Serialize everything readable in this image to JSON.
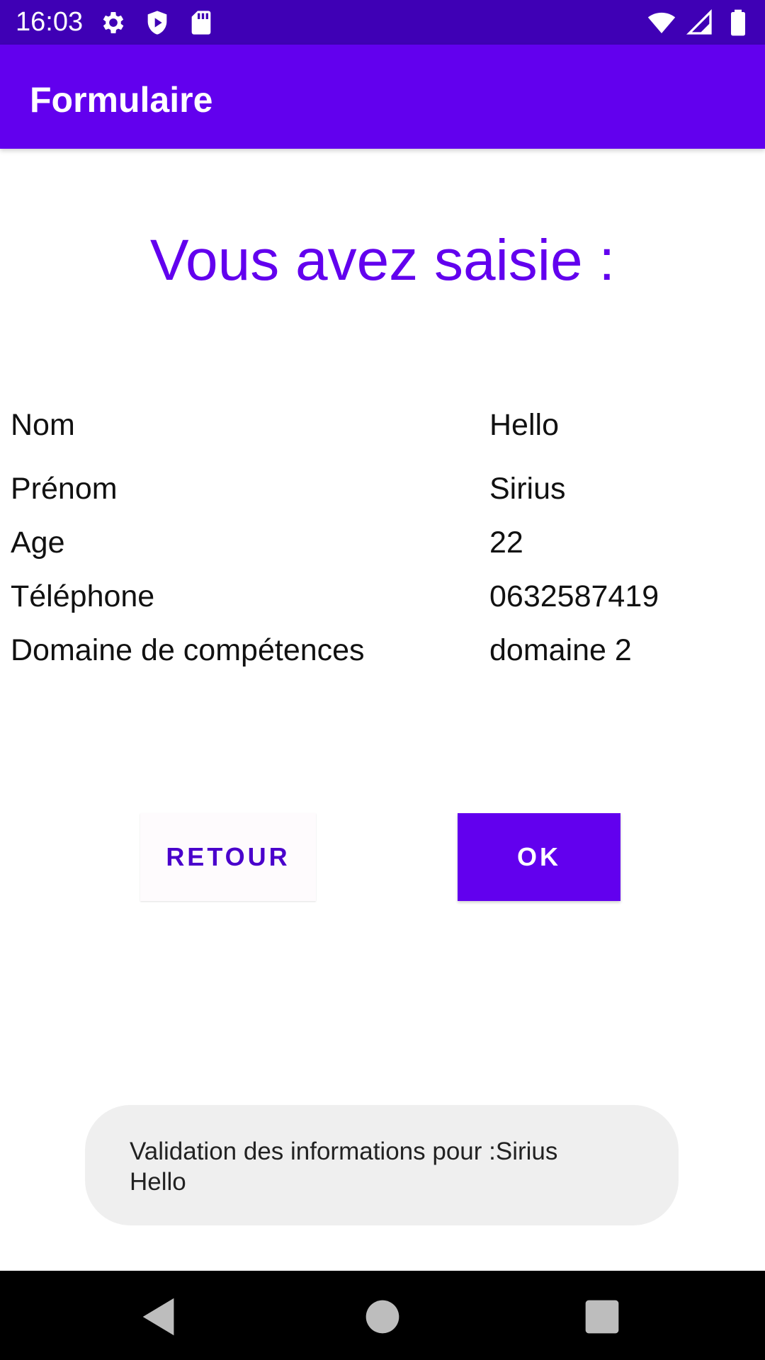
{
  "status_bar": {
    "time": "16:03",
    "left_icons": [
      "gear-icon",
      "shield-icon",
      "sd-card-icon"
    ],
    "right_icons": [
      "wifi-icon",
      "signal-icon",
      "battery-icon"
    ]
  },
  "app_bar": {
    "title": "Formulaire",
    "color": "#6200ee"
  },
  "heading": "Vous avez saisie :",
  "rows": [
    {
      "label": "Nom",
      "value": "Hello"
    },
    {
      "label": "Prénom",
      "value": "Sirius"
    },
    {
      "label": "Age",
      "value": "22"
    },
    {
      "label": "Téléphone",
      "value": "0632587419"
    },
    {
      "label": "Domaine de compétences",
      "value": "domaine 2"
    }
  ],
  "buttons": {
    "retour": "RETOUR",
    "ok": "OK"
  },
  "toast": {
    "line1": "Validation des informations pour :Sirius",
    "line2": "Hello"
  },
  "nav_bar": {
    "icons": [
      "back-icon",
      "home-icon",
      "recents-icon"
    ]
  },
  "colors": {
    "status_bar": "#3f00b5",
    "primary": "#6200ee",
    "toast_bg": "#efefef"
  }
}
